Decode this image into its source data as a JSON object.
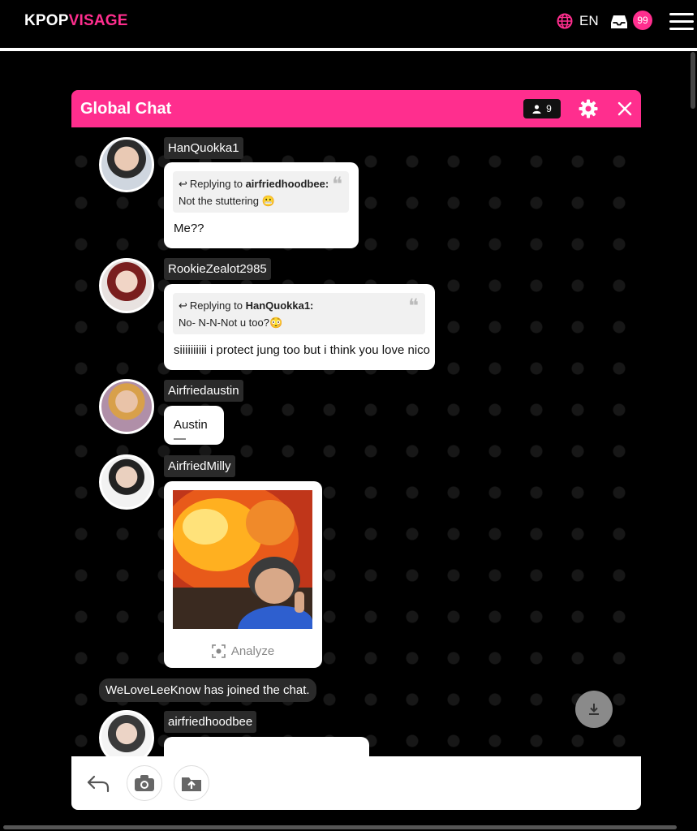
{
  "header": {
    "logo_part1": "KPOP",
    "logo_part2": "VISAGE",
    "language": "EN",
    "inbox_count": "99",
    "accent_color": "#ff2e8e"
  },
  "chat": {
    "title": "Global Chat",
    "online_count": "9",
    "messages": [
      {
        "username": "HanQuokka1",
        "reply_prefix": "Replying to",
        "reply_to": "airfriedhoodbee:",
        "reply_text": "Not the stuttering 😬",
        "text": "Me??"
      },
      {
        "username": "RookieZealot2985",
        "reply_prefix": "Replying to",
        "reply_to": "HanQuokka1:",
        "reply_text": "No- N-N-Not u too?😳",
        "text": "siiiiiiiiii i protect jung too but i think you love nico"
      },
      {
        "username": "Airfriedaustin",
        "text": "Austin—"
      },
      {
        "username": "AirfriedMilly",
        "image": "meme-photo",
        "analyze_label": "Analyze"
      },
      {
        "username": "airfriedhoodbee"
      }
    ],
    "system_message": "WeLoveLeeKnow has joined the chat."
  },
  "icons": {
    "globe": "globe-icon",
    "inbox": "inbox-icon",
    "menu": "hamburger-menu-icon",
    "user": "user-icon",
    "settings": "gear-icon",
    "close": "close-icon",
    "reply": "reply-arrow-icon",
    "quote": "quote-icon",
    "scan": "scan-icon",
    "download": "download-icon",
    "back": "back-arrow-icon",
    "camera": "camera-icon",
    "upload": "upload-icon"
  }
}
